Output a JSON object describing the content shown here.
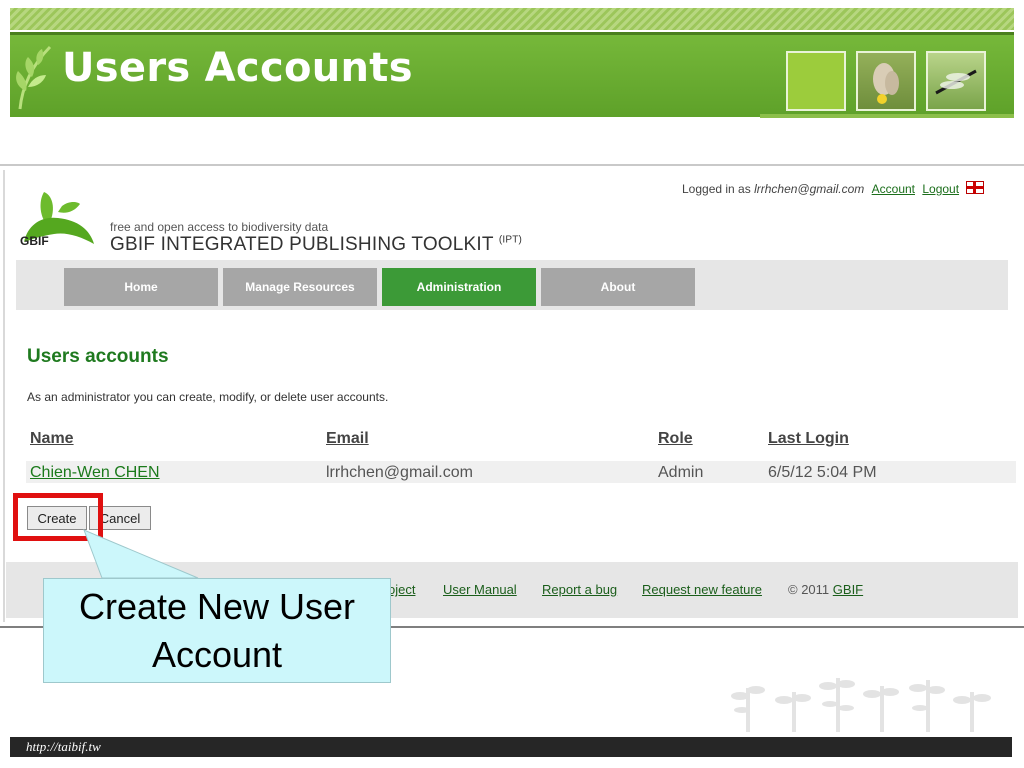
{
  "slide": {
    "title": "Users Accounts",
    "footer_url": "http://taibif.tw",
    "callout_text": "Create New User Account",
    "highlight_color": "#e01010"
  },
  "session": {
    "logged_in_prefix": "Logged in as",
    "user_email": "lrrhchen@gmail.com",
    "account_link": "Account",
    "logout_link": "Logout"
  },
  "brand": {
    "logo_text": "GBIF",
    "tagline": "free and open access to biodiversity data",
    "product_name": "GBIF INTEGRATED PUBLISHING TOOLKIT",
    "product_abbr": "(IPT)",
    "accent": "#3c9a37"
  },
  "nav": {
    "tabs": [
      {
        "label": "Home",
        "active": false
      },
      {
        "label": "Manage Resources",
        "active": false
      },
      {
        "label": "Administration",
        "active": true
      },
      {
        "label": "About",
        "active": false
      }
    ]
  },
  "main": {
    "heading": "Users accounts",
    "intro": "As an administrator you can create, modify, or delete user accounts.",
    "table": {
      "columns": [
        "Name",
        "Email",
        "Role",
        "Last Login"
      ],
      "rows": [
        {
          "name": "Chien-Wen CHEN",
          "email": "lrrhchen@gmail.com",
          "role": "Admin",
          "last_login": "6/5/12 5:04 PM"
        }
      ]
    },
    "buttons": {
      "create": "Create",
      "cancel": "Cancel"
    }
  },
  "footer": {
    "links": [
      "oject",
      "User Manual",
      "Report a bug",
      "Request new feature"
    ],
    "copyright_prefix": "© 2011",
    "copyright_link": "GBIF"
  }
}
